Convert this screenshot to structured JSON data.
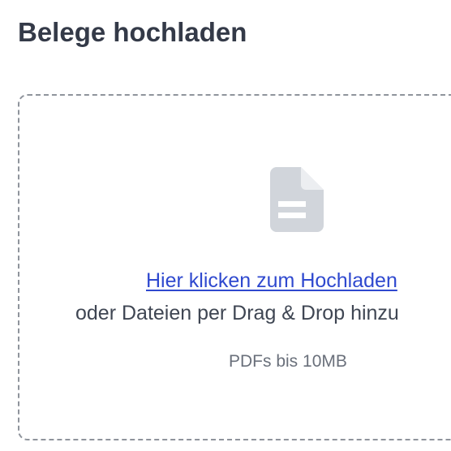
{
  "page": {
    "title": "Belege hochladen"
  },
  "upload": {
    "icon": "document-icon",
    "link_text": "Hier klicken zum Hochladen",
    "drag_text": "oder Dateien per Drag & Drop hinzu",
    "limit_text": "PDFs bis 10MB"
  },
  "colors": {
    "title": "#343a48",
    "link": "#2f49cf",
    "body_text": "#3f4653",
    "muted_text": "#6a707b",
    "icon": "#d1d5db",
    "border": "#8f949c"
  }
}
